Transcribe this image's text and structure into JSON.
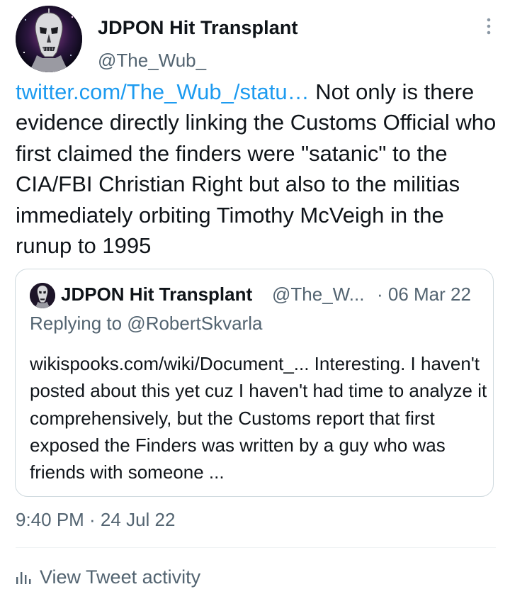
{
  "author": {
    "display_name": "JDPON Hit Transplant",
    "handle": "@The_Wub_",
    "avatar_icon": "skull-portrait-avatar"
  },
  "tweet": {
    "link_text": "twitter.com/The_Wub_/statu…",
    "body": "Not only is there evidence directly linking the Customs Official who first claimed the finders were \"satanic\" to the CIA/FBI Christian Right but also to the militias immediately orbiting Timothy McVeigh in the runup to 1995"
  },
  "quote": {
    "display_name": "JDPON Hit Transplant",
    "handle": "@The_W...",
    "date": "· 06 Mar 22",
    "replying_to": "Replying to @RobertSkvarla",
    "text": "wikispooks.com/wiki/Document_... Interesting. I haven't posted about this yet cuz I haven't had time to analyze it comprehensively, but the Customs report that first exposed the Finders was written by a guy who was friends with someone ..."
  },
  "meta": {
    "timestamp": "9:40 PM · 24 Jul 22",
    "activity_label": "View Tweet activity"
  },
  "colors": {
    "link": "#1d9bf0",
    "secondary_text": "#536471",
    "border": "#cfd9de"
  }
}
